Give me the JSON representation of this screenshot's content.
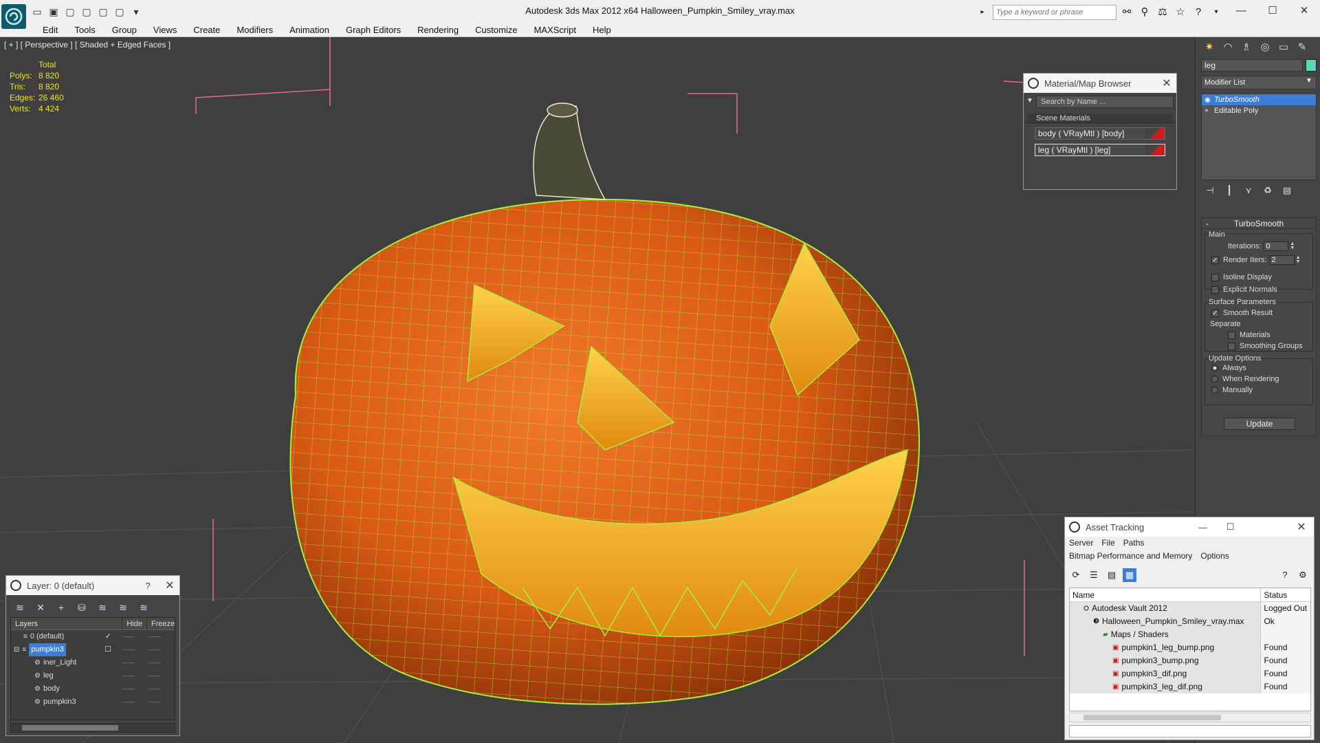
{
  "window": {
    "title": "Autodesk 3ds Max  2012 x64     Halloween_Pumpkin_Smiley_vray.max",
    "search_placeholder": "Type a keyword or phrase",
    "controls": [
      "—",
      "☐",
      "✕"
    ]
  },
  "menu": [
    "Edit",
    "Tools",
    "Group",
    "Views",
    "Create",
    "Modifiers",
    "Animation",
    "Graph Editors",
    "Rendering",
    "Customize",
    "MAXScript",
    "Help"
  ],
  "viewport": {
    "label": "[ + ] [ Perspective ] [ Shaded + Edged Faces ]",
    "stats": {
      "header": "Total",
      "rows": [
        {
          "k": "Polys:",
          "v": "8 820"
        },
        {
          "k": "Tris:",
          "v": "8 820"
        },
        {
          "k": "Edges:",
          "v": "26 460"
        },
        {
          "k": "Verts:",
          "v": "4 424"
        }
      ]
    }
  },
  "material_browser": {
    "title": "Material/Map Browser",
    "search": "Search by Name ...",
    "group": "Scene Materials",
    "materials": [
      "body  ( VRayMtl ) [body]",
      "leg  ( VRayMtl ) [leg]"
    ]
  },
  "command_panel": {
    "object_name": "leg",
    "modifier_list": "Modifier List",
    "stack": [
      "TurboSmooth",
      "Editable Poly"
    ],
    "rollout": {
      "title": "TurboSmooth",
      "main": "Main",
      "iterations_label": "Iterations:",
      "iterations": "0",
      "render_iters_label": "Render Iters:",
      "render_iters": "2",
      "isoline": "Isoline Display",
      "explicit": "Explicit Normals",
      "surface": "Surface Parameters",
      "smooth_result": "Smooth Result",
      "separate": "Separate",
      "materials": "Materials",
      "smoothing_groups": "Smoothing Groups",
      "update_options": "Update Options",
      "always": "Always",
      "when_rendering": "When Rendering",
      "manually": "Manually",
      "update": "Update"
    },
    "color": "#5dd6b8"
  },
  "layer_manager": {
    "title": "Layer: 0 (default)",
    "help": "?",
    "columns": [
      "Layers",
      "Hide",
      "Freeze"
    ],
    "rows": [
      {
        "name": "0 (default)",
        "level": 0,
        "check": "✓"
      },
      {
        "name": "pumpkin3",
        "level": 0,
        "check": "☐"
      },
      {
        "name": "iner_Light",
        "level": 1,
        "check": ""
      },
      {
        "name": "leg",
        "level": 1,
        "check": ""
      },
      {
        "name": "body",
        "level": 1,
        "check": ""
      },
      {
        "name": "pumpkin3",
        "level": 1,
        "check": ""
      }
    ],
    "dash": "——"
  },
  "asset_tracking": {
    "title": "Asset Tracking",
    "menu": [
      "Server",
      "File",
      "Paths",
      "Bitmap Performance and Memory",
      "Options"
    ],
    "columns": [
      "Name",
      "Status"
    ],
    "rows": [
      {
        "name": "Autodesk Vault 2012",
        "status": "Logged Out",
        "indent": 1
      },
      {
        "name": "Halloween_Pumpkin_Smiley_vray.max",
        "status": "Ok",
        "indent": 2
      },
      {
        "name": "Maps / Shaders",
        "status": "",
        "indent": 3
      },
      {
        "name": "pumpkin1_leg_bump.png",
        "status": "Found",
        "indent": 4
      },
      {
        "name": "pumpkin3_bump.png",
        "status": "Found",
        "indent": 4
      },
      {
        "name": "pumpkin3_dif.png",
        "status": "Found",
        "indent": 4
      },
      {
        "name": "pumpkin3_leg_dif.png",
        "status": "Found",
        "indent": 4
      }
    ]
  },
  "colors": {
    "accent": "#3e7dd6",
    "pumpkin": "#e0651a",
    "wire": "#b6ff3a",
    "stats": "#f5e600"
  }
}
